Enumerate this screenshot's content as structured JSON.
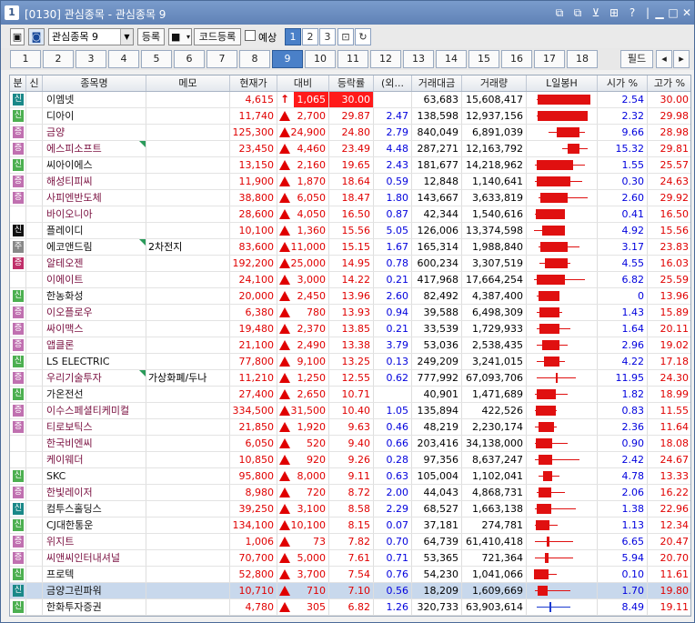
{
  "window": {
    "number": "1",
    "title": "[0130] 관심종목 - 관심종목 9",
    "controls": [
      "⧉",
      "⧉",
      "⊻",
      "⊞",
      "?",
      "|",
      "▁",
      "□",
      "✕"
    ]
  },
  "toolbar": {
    "watchlist": "관심종목 9",
    "register": "등록",
    "code_register": "코드등록",
    "preview": "예상",
    "pages": [
      "1",
      "2",
      "3"
    ],
    "active_page": "1"
  },
  "tabs": {
    "items": [
      "1",
      "2",
      "3",
      "4",
      "5",
      "6",
      "7",
      "8",
      "9",
      "10",
      "11",
      "12",
      "13",
      "14",
      "15",
      "16",
      "17",
      "18"
    ],
    "active": "9",
    "field_label": "필드",
    "prev": "◂",
    "next": "▸"
  },
  "columns": [
    "분",
    "신",
    "종목명",
    "메모",
    "현재가",
    "대비",
    "등락률",
    "(외...",
    "거래대금",
    "거래량",
    "L일봉H",
    "시가 %",
    "고가 %"
  ],
  "rows": [
    {
      "mk": "신",
      "mc": "t",
      "name": "이엠넷",
      "memo": "",
      "price": "4,615",
      "diff": "1,065",
      "rate": "30.00",
      "frgn": "",
      "amount": "63,683",
      "volume": "15,608,417",
      "open": "2.54",
      "high": "30.00",
      "up": "arrow",
      "limit": true,
      "c": [
        0.05,
        0.95,
        0.06,
        1.0,
        "r"
      ]
    },
    {
      "mk": "신",
      "mc": "g",
      "name": "디아이",
      "memo": "",
      "price": "11,740",
      "diff": "2,700",
      "rate": "29.87",
      "frgn": "2.47",
      "amount": "138,598",
      "volume": "12,937,156",
      "open": "2.32",
      "high": "29.98",
      "c": [
        0.05,
        0.95,
        0.06,
        0.95,
        "r"
      ]
    },
    {
      "mk": "증",
      "mc": "p",
      "name": "금양",
      "memo": "",
      "price": "125,300",
      "diff": "24,900",
      "rate": "24.80",
      "frgn": "2.79",
      "amount": "840,049",
      "volume": "6,891,039",
      "open": "9.66",
      "high": "28.98",
      "c": [
        0.25,
        0.9,
        0.4,
        0.8,
        "r"
      ]
    },
    {
      "mk": "증",
      "mc": "p",
      "name": "에스피소프트",
      "memo": "",
      "price": "23,450",
      "diff": "4,460",
      "rate": "23.49",
      "frgn": "4.48",
      "amount": "287,271",
      "volume": "12,163,792",
      "open": "15.32",
      "high": "29.81",
      "c": [
        0.5,
        0.95,
        0.6,
        0.8,
        "r"
      ],
      "flag": true
    },
    {
      "mk": "신",
      "mc": "g",
      "name": "씨아이에스",
      "memo": "",
      "price": "13,150",
      "diff": "2,160",
      "rate": "19.65",
      "frgn": "2.43",
      "amount": "181,677",
      "volume": "14,218,962",
      "open": "1.55",
      "high": "25.57",
      "c": [
        0.02,
        0.9,
        0.05,
        0.7,
        "r"
      ]
    },
    {
      "mk": "증",
      "mc": "p",
      "name": "해성티피씨",
      "memo": "",
      "price": "11,900",
      "diff": "1,870",
      "rate": "18.64",
      "frgn": "0.59",
      "amount": "12,848",
      "volume": "1,140,641",
      "open": "0.30",
      "high": "24.63",
      "c": [
        0.02,
        0.85,
        0.05,
        0.65,
        "r"
      ]
    },
    {
      "mk": "증",
      "mc": "p",
      "name": "사피엔반도체",
      "memo": "",
      "price": "38,800",
      "diff": "6,050",
      "rate": "18.47",
      "frgn": "1.80",
      "amount": "143,667",
      "volume": "3,633,819",
      "open": "2.60",
      "high": "29.92",
      "c": [
        0.08,
        0.95,
        0.12,
        0.6,
        "r"
      ]
    },
    {
      "mk": "",
      "mc": "",
      "name": "바이오니아",
      "memo": "",
      "price": "28,600",
      "diff": "4,050",
      "rate": "16.50",
      "frgn": "0.87",
      "amount": "42,344",
      "volume": "1,540,616",
      "open": "0.41",
      "high": "16.50",
      "c": [
        0.02,
        0.55,
        0.03,
        0.55,
        "r"
      ]
    },
    {
      "mk": "신",
      "mc": "k",
      "name": "플레이디",
      "memo": "",
      "price": "10,100",
      "diff": "1,360",
      "rate": "15.56",
      "frgn": "5.05",
      "amount": "126,006",
      "volume": "13,374,598",
      "open": "4.92",
      "high": "15.56",
      "c": [
        0.0,
        0.55,
        0.15,
        0.55,
        "r"
      ]
    },
    {
      "mk": "주",
      "mc": "gy",
      "name": "에코앤드림",
      "memo": "2차전지",
      "price": "83,600",
      "diff": "11,000",
      "rate": "15.15",
      "frgn": "1.67",
      "amount": "165,314",
      "volume": "1,988,840",
      "open": "3.17",
      "high": "23.83",
      "c": [
        0.08,
        0.8,
        0.12,
        0.6,
        "r"
      ],
      "flag": true
    },
    {
      "mk": "증",
      "mc": "m",
      "name": "알테오젠",
      "memo": "",
      "price": "192,200",
      "diff": "25,000",
      "rate": "14.95",
      "frgn": "0.78",
      "amount": "600,234",
      "volume": "3,307,519",
      "open": "4.55",
      "high": "16.03",
      "c": [
        0.1,
        0.65,
        0.2,
        0.6,
        "r"
      ]
    },
    {
      "mk": "",
      "mc": "",
      "name": "이에이트",
      "memo": "",
      "price": "24,100",
      "diff": "3,000",
      "rate": "14.22",
      "frgn": "0.21",
      "amount": "417,968",
      "volume": "17,664,254",
      "open": "6.82",
      "high": "25.59",
      "c": [
        0.0,
        0.9,
        0.05,
        0.55,
        "r"
      ]
    },
    {
      "mk": "신",
      "mc": "g",
      "name": "한농화성",
      "memo": "",
      "price": "20,000",
      "diff": "2,450",
      "rate": "13.96",
      "frgn": "2.60",
      "amount": "82,492",
      "volume": "4,387,400",
      "open": "0",
      "high": "13.96",
      "c": [
        0.05,
        0.45,
        0.08,
        0.45,
        "r"
      ]
    },
    {
      "mk": "증",
      "mc": "p",
      "name": "이오플로우",
      "memo": "",
      "price": "6,380",
      "diff": "780",
      "rate": "13.93",
      "frgn": "0.94",
      "amount": "39,588",
      "volume": "6,498,309",
      "open": "1.43",
      "high": "15.89",
      "c": [
        0.05,
        0.5,
        0.1,
        0.45,
        "r"
      ]
    },
    {
      "mk": "증",
      "mc": "p",
      "name": "싸이맥스",
      "memo": "",
      "price": "19,480",
      "diff": "2,370",
      "rate": "13.85",
      "frgn": "0.21",
      "amount": "33,539",
      "volume": "1,729,933",
      "open": "1.64",
      "high": "20.11",
      "c": [
        0.05,
        0.65,
        0.1,
        0.45,
        "r"
      ]
    },
    {
      "mk": "증",
      "mc": "p",
      "name": "앱클론",
      "memo": "",
      "price": "21,100",
      "diff": "2,490",
      "rate": "13.38",
      "frgn": "3.79",
      "amount": "53,036",
      "volume": "2,538,435",
      "open": "2.96",
      "high": "19.02",
      "c": [
        0.05,
        0.6,
        0.15,
        0.45,
        "r"
      ]
    },
    {
      "mk": "신",
      "mc": "g",
      "name": "LS ELECTRIC",
      "memo": "",
      "price": "77,800",
      "diff": "9,100",
      "rate": "13.25",
      "frgn": "0.13",
      "amount": "249,209",
      "volume": "3,241,015",
      "open": "4.22",
      "high": "17.18",
      "c": [
        0.05,
        0.55,
        0.18,
        0.45,
        "r"
      ]
    },
    {
      "mk": "증",
      "mc": "p",
      "name": "우리기술투자",
      "memo": "가상화폐/두나",
      "price": "11,210",
      "diff": "1,250",
      "rate": "12.55",
      "frgn": "0.62",
      "amount": "777,992",
      "volume": "67,093,706",
      "open": "11.95",
      "high": "24.30",
      "c": [
        0.05,
        0.75,
        0.38,
        0.42,
        "r"
      ],
      "flag": true
    },
    {
      "mk": "신",
      "mc": "g",
      "name": "가온전선",
      "memo": "",
      "price": "27,400",
      "diff": "2,650",
      "rate": "10.71",
      "frgn": "",
      "amount": "40,901",
      "volume": "1,471,689",
      "open": "1.82",
      "high": "18.99",
      "c": [
        0.02,
        0.6,
        0.05,
        0.38,
        "r"
      ]
    },
    {
      "mk": "증",
      "mc": "p",
      "name": "이수스페셜티케미컬",
      "memo": "",
      "price": "334,500",
      "diff": "31,500",
      "rate": "10.40",
      "frgn": "1.05",
      "amount": "135,894",
      "volume": "422,526",
      "open": "0.83",
      "high": "11.55",
      "c": [
        0.02,
        0.4,
        0.04,
        0.38,
        "r"
      ]
    },
    {
      "mk": "증",
      "mc": "p",
      "name": "티로보틱스",
      "memo": "",
      "price": "21,850",
      "diff": "1,920",
      "rate": "9.63",
      "frgn": "0.46",
      "amount": "48,219",
      "volume": "2,230,174",
      "open": "2.36",
      "high": "11.64",
      "c": [
        0.02,
        0.4,
        0.08,
        0.35,
        "r"
      ]
    },
    {
      "mk": "",
      "mc": "",
      "name": "한국비엔씨",
      "memo": "",
      "price": "6,050",
      "diff": "520",
      "rate": "9.40",
      "frgn": "0.66",
      "amount": "203,416",
      "volume": "34,138,000",
      "open": "0.90",
      "high": "18.08",
      "c": [
        0.02,
        0.6,
        0.04,
        0.33,
        "r"
      ]
    },
    {
      "mk": "",
      "mc": "",
      "name": "케이웨더",
      "memo": "",
      "price": "10,850",
      "diff": "920",
      "rate": "9.26",
      "frgn": "0.28",
      "amount": "97,356",
      "volume": "8,637,247",
      "open": "2.42",
      "high": "24.67",
      "c": [
        0.02,
        0.8,
        0.08,
        0.33,
        "r"
      ]
    },
    {
      "mk": "신",
      "mc": "g",
      "name": "SKC",
      "memo": "",
      "price": "95,800",
      "diff": "8,000",
      "rate": "9.11",
      "frgn": "0.63",
      "amount": "105,004",
      "volume": "1,102,041",
      "open": "4.78",
      "high": "13.33",
      "c": [
        0.08,
        0.45,
        0.16,
        0.32,
        "r"
      ]
    },
    {
      "mk": "증",
      "mc": "p",
      "name": "한빛레이저",
      "memo": "",
      "price": "8,980",
      "diff": "720",
      "rate": "8.72",
      "frgn": "2.00",
      "amount": "44,043",
      "volume": "4,868,731",
      "open": "2.06",
      "high": "16.22",
      "c": [
        0.05,
        0.55,
        0.08,
        0.3,
        "r"
      ]
    },
    {
      "mk": "신",
      "mc": "t",
      "name": "컴투스홀딩스",
      "memo": "",
      "price": "39,250",
      "diff": "3,100",
      "rate": "8.58",
      "frgn": "2.29",
      "amount": "68,527",
      "volume": "1,663,138",
      "open": "1.38",
      "high": "22.96",
      "c": [
        0.02,
        0.75,
        0.05,
        0.3,
        "r"
      ]
    },
    {
      "mk": "신",
      "mc": "g",
      "name": "CJ대한통운",
      "memo": "",
      "price": "134,100",
      "diff": "10,100",
      "rate": "8.15",
      "frgn": "0.07",
      "amount": "37,181",
      "volume": "274,781",
      "open": "1.13",
      "high": "12.34",
      "c": [
        0.02,
        0.42,
        0.04,
        0.28,
        "r"
      ]
    },
    {
      "mk": "증",
      "mc": "p",
      "name": "위지트",
      "memo": "",
      "price": "1,006",
      "diff": "73",
      "rate": "7.82",
      "frgn": "0.70",
      "amount": "64,739",
      "volume": "61,410,418",
      "open": "6.65",
      "high": "20.47",
      "c": [
        0.02,
        0.7,
        0.22,
        0.27,
        "r"
      ]
    },
    {
      "mk": "증",
      "mc": "p",
      "name": "씨앤씨인터내셔널",
      "memo": "",
      "price": "70,700",
      "diff": "5,000",
      "rate": "7.61",
      "frgn": "0.71",
      "amount": "53,365",
      "volume": "721,364",
      "open": "5.94",
      "high": "20.70",
      "c": [
        0.02,
        0.7,
        0.2,
        0.26,
        "r"
      ]
    },
    {
      "mk": "신",
      "mc": "g",
      "name": "프로텍",
      "memo": "",
      "price": "52,800",
      "diff": "3,700",
      "rate": "7.54",
      "frgn": "0.76",
      "amount": "54,230",
      "volume": "1,041,066",
      "open": "0.10",
      "high": "11.61",
      "c": [
        0.0,
        0.4,
        0.0,
        0.26,
        "r"
      ]
    },
    {
      "mk": "신",
      "mc": "t",
      "name": "금양그린파워",
      "memo": "",
      "price": "10,710",
      "diff": "710",
      "rate": "7.10",
      "frgn": "0.56",
      "amount": "18,209",
      "volume": "1,609,669",
      "open": "1.70",
      "high": "19.80",
      "c": [
        0.02,
        0.65,
        0.06,
        0.25,
        "r"
      ],
      "sel": true
    },
    {
      "mk": "신",
      "mc": "g",
      "name": "한화투자증권",
      "memo": "",
      "price": "4,780",
      "diff": "305",
      "rate": "6.82",
      "frgn": "1.26",
      "amount": "320,733",
      "volume": "63,903,614",
      "open": "8.49",
      "high": "19.11",
      "c": [
        0.05,
        0.65,
        0.27,
        0.28,
        "b"
      ]
    }
  ]
}
